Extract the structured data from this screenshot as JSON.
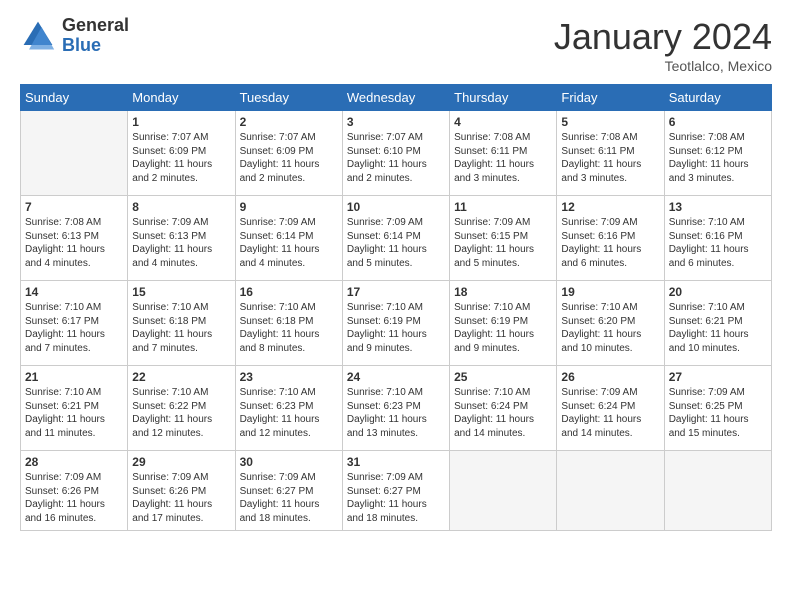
{
  "header": {
    "logo_general": "General",
    "logo_blue": "Blue",
    "month_title": "January 2024",
    "location": "Teotlalco, Mexico"
  },
  "days_of_week": [
    "Sunday",
    "Monday",
    "Tuesday",
    "Wednesday",
    "Thursday",
    "Friday",
    "Saturday"
  ],
  "weeks": [
    [
      {
        "day": "",
        "info": ""
      },
      {
        "day": "1",
        "info": "Sunrise: 7:07 AM\nSunset: 6:09 PM\nDaylight: 11 hours\nand 2 minutes."
      },
      {
        "day": "2",
        "info": "Sunrise: 7:07 AM\nSunset: 6:09 PM\nDaylight: 11 hours\nand 2 minutes."
      },
      {
        "day": "3",
        "info": "Sunrise: 7:07 AM\nSunset: 6:10 PM\nDaylight: 11 hours\nand 2 minutes."
      },
      {
        "day": "4",
        "info": "Sunrise: 7:08 AM\nSunset: 6:11 PM\nDaylight: 11 hours\nand 3 minutes."
      },
      {
        "day": "5",
        "info": "Sunrise: 7:08 AM\nSunset: 6:11 PM\nDaylight: 11 hours\nand 3 minutes."
      },
      {
        "day": "6",
        "info": "Sunrise: 7:08 AM\nSunset: 6:12 PM\nDaylight: 11 hours\nand 3 minutes."
      }
    ],
    [
      {
        "day": "7",
        "info": "Sunrise: 7:08 AM\nSunset: 6:13 PM\nDaylight: 11 hours\nand 4 minutes."
      },
      {
        "day": "8",
        "info": "Sunrise: 7:09 AM\nSunset: 6:13 PM\nDaylight: 11 hours\nand 4 minutes."
      },
      {
        "day": "9",
        "info": "Sunrise: 7:09 AM\nSunset: 6:14 PM\nDaylight: 11 hours\nand 4 minutes."
      },
      {
        "day": "10",
        "info": "Sunrise: 7:09 AM\nSunset: 6:14 PM\nDaylight: 11 hours\nand 5 minutes."
      },
      {
        "day": "11",
        "info": "Sunrise: 7:09 AM\nSunset: 6:15 PM\nDaylight: 11 hours\nand 5 minutes."
      },
      {
        "day": "12",
        "info": "Sunrise: 7:09 AM\nSunset: 6:16 PM\nDaylight: 11 hours\nand 6 minutes."
      },
      {
        "day": "13",
        "info": "Sunrise: 7:10 AM\nSunset: 6:16 PM\nDaylight: 11 hours\nand 6 minutes."
      }
    ],
    [
      {
        "day": "14",
        "info": "Sunrise: 7:10 AM\nSunset: 6:17 PM\nDaylight: 11 hours\nand 7 minutes."
      },
      {
        "day": "15",
        "info": "Sunrise: 7:10 AM\nSunset: 6:18 PM\nDaylight: 11 hours\nand 7 minutes."
      },
      {
        "day": "16",
        "info": "Sunrise: 7:10 AM\nSunset: 6:18 PM\nDaylight: 11 hours\nand 8 minutes."
      },
      {
        "day": "17",
        "info": "Sunrise: 7:10 AM\nSunset: 6:19 PM\nDaylight: 11 hours\nand 9 minutes."
      },
      {
        "day": "18",
        "info": "Sunrise: 7:10 AM\nSunset: 6:19 PM\nDaylight: 11 hours\nand 9 minutes."
      },
      {
        "day": "19",
        "info": "Sunrise: 7:10 AM\nSunset: 6:20 PM\nDaylight: 11 hours\nand 10 minutes."
      },
      {
        "day": "20",
        "info": "Sunrise: 7:10 AM\nSunset: 6:21 PM\nDaylight: 11 hours\nand 10 minutes."
      }
    ],
    [
      {
        "day": "21",
        "info": "Sunrise: 7:10 AM\nSunset: 6:21 PM\nDaylight: 11 hours\nand 11 minutes."
      },
      {
        "day": "22",
        "info": "Sunrise: 7:10 AM\nSunset: 6:22 PM\nDaylight: 11 hours\nand 12 minutes."
      },
      {
        "day": "23",
        "info": "Sunrise: 7:10 AM\nSunset: 6:23 PM\nDaylight: 11 hours\nand 12 minutes."
      },
      {
        "day": "24",
        "info": "Sunrise: 7:10 AM\nSunset: 6:23 PM\nDaylight: 11 hours\nand 13 minutes."
      },
      {
        "day": "25",
        "info": "Sunrise: 7:10 AM\nSunset: 6:24 PM\nDaylight: 11 hours\nand 14 minutes."
      },
      {
        "day": "26",
        "info": "Sunrise: 7:09 AM\nSunset: 6:24 PM\nDaylight: 11 hours\nand 14 minutes."
      },
      {
        "day": "27",
        "info": "Sunrise: 7:09 AM\nSunset: 6:25 PM\nDaylight: 11 hours\nand 15 minutes."
      }
    ],
    [
      {
        "day": "28",
        "info": "Sunrise: 7:09 AM\nSunset: 6:26 PM\nDaylight: 11 hours\nand 16 minutes."
      },
      {
        "day": "29",
        "info": "Sunrise: 7:09 AM\nSunset: 6:26 PM\nDaylight: 11 hours\nand 17 minutes."
      },
      {
        "day": "30",
        "info": "Sunrise: 7:09 AM\nSunset: 6:27 PM\nDaylight: 11 hours\nand 18 minutes."
      },
      {
        "day": "31",
        "info": "Sunrise: 7:09 AM\nSunset: 6:27 PM\nDaylight: 11 hours\nand 18 minutes."
      },
      {
        "day": "",
        "info": ""
      },
      {
        "day": "",
        "info": ""
      },
      {
        "day": "",
        "info": ""
      }
    ]
  ]
}
